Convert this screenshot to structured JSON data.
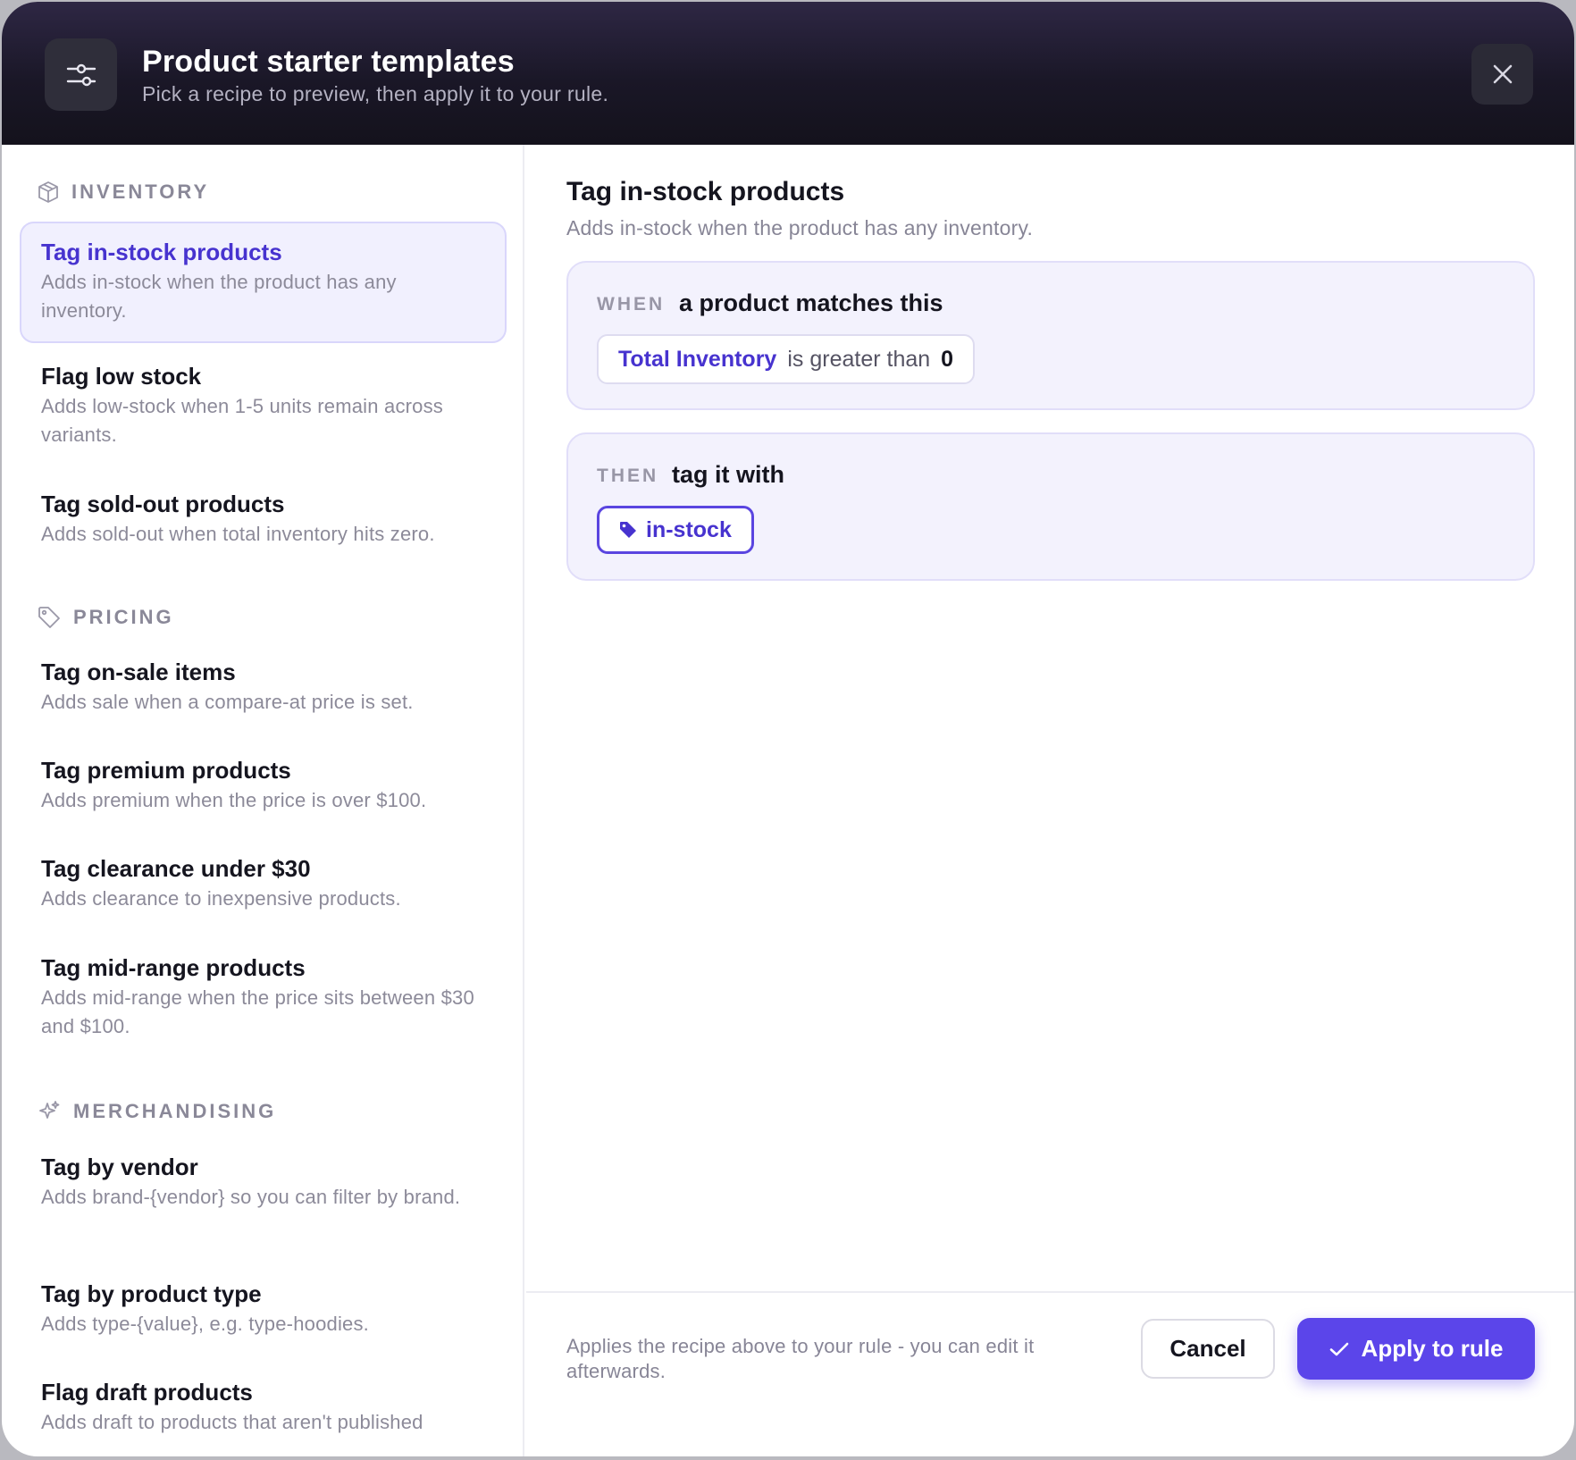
{
  "header": {
    "icon": "sliders-icon",
    "title": "Product starter templates",
    "subtitle": "Pick a recipe to preview, then apply it to your rule.",
    "close_icon": "close-icon"
  },
  "sidebar": {
    "sections": [
      {
        "label": "INVENTORY",
        "icon": "box-icon",
        "items": [
          {
            "title": "Tag in-stock products",
            "desc": "Adds in-stock when the product has any inventory.",
            "selected": true
          },
          {
            "title": "Flag low stock",
            "desc": "Adds low-stock when 1-5 units remain across variants."
          },
          {
            "title": "Tag sold-out products",
            "desc": "Adds sold-out when total inventory hits zero."
          }
        ]
      },
      {
        "label": "PRICING",
        "icon": "price-tag-icon",
        "items": [
          {
            "title": "Tag on-sale items",
            "desc": "Adds sale when a compare-at price is set."
          },
          {
            "title": "Tag premium products",
            "desc": "Adds premium when the price is over $100."
          },
          {
            "title": "Tag clearance under $30",
            "desc": "Adds clearance to inexpensive products."
          },
          {
            "title": "Tag mid-range products",
            "desc": "Adds mid-range when the price sits between $30 and $100."
          }
        ]
      },
      {
        "label": "MERCHANDISING",
        "icon": "sparkle-icon",
        "items": [
          {
            "title": "Tag by vendor",
            "desc": "Adds brand-{vendor} so you can filter by brand."
          },
          {
            "title": "Tag by product type",
            "desc": "Adds type-{value}, e.g. type-hoodies."
          },
          {
            "title": "Flag draft products",
            "desc": "Adds draft to products that aren't published"
          }
        ]
      }
    ]
  },
  "preview": {
    "title": "Tag in-stock products",
    "subtitle": "Adds in-stock when the product has any inventory.",
    "when": {
      "keyword": "WHEN",
      "text": "a product matches this",
      "condition": {
        "field": "Total Inventory",
        "operator": "is greater than",
        "value": "0"
      }
    },
    "then": {
      "keyword": "THEN",
      "text": "tag it with",
      "tag": "in-stock",
      "tag_icon": "tag-icon"
    }
  },
  "footer": {
    "note": "Applies the recipe above to your rule - you can edit it afterwards.",
    "cancel_label": "Cancel",
    "apply_label": "Apply to rule",
    "apply_icon": "check-icon"
  },
  "colors": {
    "accent": "#5b45ea",
    "accent_text": "#4733cf",
    "selected_bg": "#f1f0fe",
    "header_bg": "#1a1727"
  }
}
